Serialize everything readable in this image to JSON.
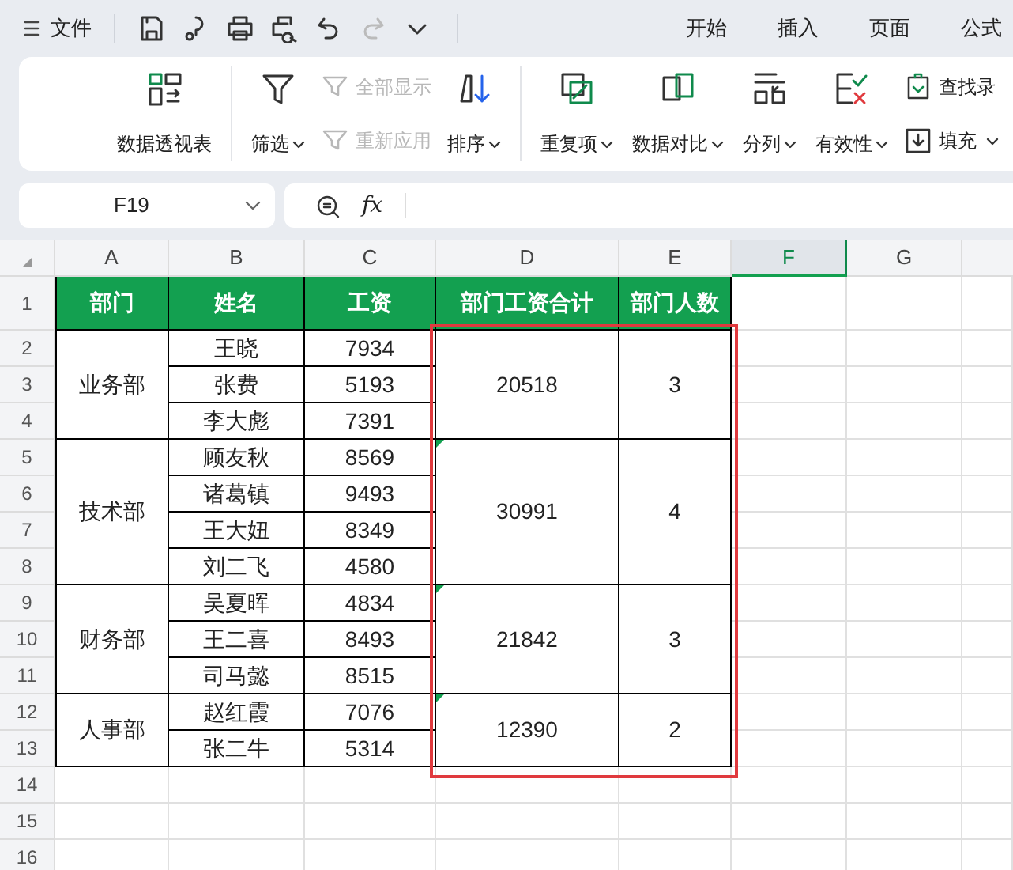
{
  "quick_bar": {
    "menu_label": "文件",
    "tools": [
      {
        "kind": "save",
        "disabled": false
      },
      {
        "kind": "format",
        "disabled": false
      },
      {
        "kind": "print",
        "disabled": false
      },
      {
        "kind": "preview",
        "disabled": false
      },
      {
        "kind": "undo",
        "disabled": false
      },
      {
        "kind": "redo",
        "disabled": true
      },
      {
        "kind": "more",
        "disabled": false
      }
    ]
  },
  "menu_tabs": [
    "开始",
    "插入",
    "页面",
    "公式"
  ],
  "ribbon": {
    "groups": [
      {
        "items": [
          {
            "kind": "large",
            "label": "数据透视表",
            "dropdown": false,
            "disabled": false
          }
        ]
      },
      {
        "items": [
          {
            "kind": "large",
            "label": "筛选",
            "dropdown": true,
            "disabled": false
          },
          {
            "kind": "stack",
            "children": [
              {
                "label": "全部显示",
                "disabled": true,
                "dropdown": false
              },
              {
                "label": "重新应用",
                "disabled": true,
                "dropdown": false
              }
            ]
          },
          {
            "kind": "large",
            "label": "排序",
            "dropdown": true,
            "disabled": false
          }
        ]
      },
      {
        "items": [
          {
            "kind": "large",
            "label": "重复项",
            "dropdown": true,
            "disabled": false
          },
          {
            "kind": "large",
            "label": "数据对比",
            "dropdown": true,
            "disabled": false
          },
          {
            "kind": "large",
            "label": "分列",
            "dropdown": true,
            "disabled": false
          },
          {
            "kind": "large",
            "label": "有效性",
            "dropdown": true,
            "disabled": false
          },
          {
            "kind": "stack",
            "children": [
              {
                "label": "查找录",
                "disabled": false,
                "dropdown": false
              },
              {
                "label": "填充",
                "disabled": false,
                "dropdown": true
              }
            ]
          }
        ]
      }
    ]
  },
  "formula_bar": {
    "name_box": "F19",
    "fx_label": "fx"
  },
  "sheet": {
    "columns": [
      {
        "label": "A",
        "selected": false
      },
      {
        "label": "B",
        "selected": false
      },
      {
        "label": "C",
        "selected": false
      },
      {
        "label": "D",
        "selected": false
      },
      {
        "label": "E",
        "selected": false
      },
      {
        "label": "F",
        "selected": true
      },
      {
        "label": "G",
        "selected": false
      }
    ],
    "row_numbers": [
      "1",
      "2",
      "3",
      "4",
      "5",
      "6",
      "7",
      "8",
      "9",
      "10",
      "11",
      "12",
      "13",
      "14",
      "15",
      "16"
    ],
    "headers": [
      "部门",
      "姓名",
      "工资",
      "部门工资合计",
      "部门人数"
    ],
    "groups": [
      {
        "department": "业务部",
        "total": "20518",
        "count": "3",
        "error_mark": false,
        "staff": [
          {
            "name": "王晓",
            "salary": "7934"
          },
          {
            "name": "张费",
            "salary": "5193"
          },
          {
            "name": "李大彪",
            "salary": "7391"
          }
        ]
      },
      {
        "department": "技术部",
        "total": "30991",
        "count": "4",
        "error_mark": true,
        "staff": [
          {
            "name": "顾友秋",
            "salary": "8569"
          },
          {
            "name": "诸葛镇",
            "salary": "9493"
          },
          {
            "name": "王大妞",
            "salary": "8349"
          },
          {
            "name": "刘二飞",
            "salary": "4580"
          }
        ]
      },
      {
        "department": "财务部",
        "total": "21842",
        "count": "3",
        "error_mark": true,
        "staff": [
          {
            "name": "吴夏晖",
            "salary": "4834"
          },
          {
            "name": "王二喜",
            "salary": "8493"
          },
          {
            "name": "司马懿",
            "salary": "8515"
          }
        ]
      },
      {
        "department": "人事部",
        "total": "12390",
        "count": "2",
        "error_mark": true,
        "staff": [
          {
            "name": "赵红霞",
            "salary": "7076"
          },
          {
            "name": "张二牛",
            "salary": "5314"
          }
        ]
      }
    ],
    "summary_frame": true
  }
}
